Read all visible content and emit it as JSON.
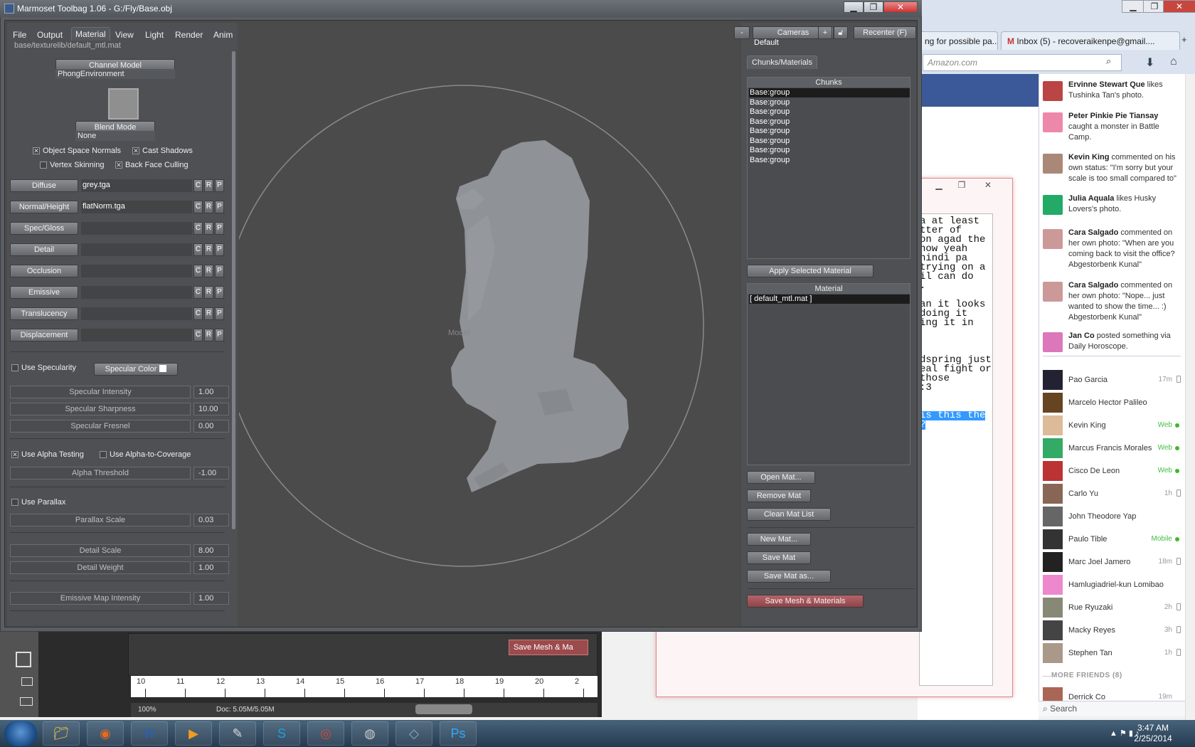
{
  "marmoset": {
    "title": "Marmoset Toolbag 1.06 - G:/Fly/Base.obj",
    "menu": [
      "File",
      "Output",
      "Material",
      "View",
      "Light",
      "Render",
      "Anim"
    ],
    "active_menu": "Material",
    "mat_path": "base/texturelib/default_mtl.mat",
    "channel_model": {
      "label": "Channel Model",
      "value": "PhongEnvironment"
    },
    "blend_mode": {
      "label": "Blend Mode",
      "value": "None"
    },
    "checks": [
      {
        "label": "Object Space Normals",
        "checked": true
      },
      {
        "label": "Cast Shadows",
        "checked": true
      },
      {
        "label": "Vertex Skinning",
        "checked": false
      },
      {
        "label": "Back Face Culling",
        "checked": true
      }
    ],
    "channels": [
      {
        "label": "Diffuse",
        "texture": "grey.tga"
      },
      {
        "label": "Normal/Height",
        "texture": "flatNorm.tga"
      },
      {
        "label": "Spec/Gloss",
        "texture": ""
      },
      {
        "label": "Detail",
        "texture": ""
      },
      {
        "label": "Occlusion",
        "texture": ""
      },
      {
        "label": "Emissive",
        "texture": ""
      },
      {
        "label": "Translucency",
        "texture": ""
      },
      {
        "label": "Displacement",
        "texture": ""
      }
    ],
    "crp": [
      "C",
      "R",
      "P"
    ],
    "use_specularity": {
      "label": "Use Specularity",
      "checked": false
    },
    "specular_color": "Specular Color",
    "spec_sliders": [
      {
        "label": "Specular Intensity",
        "value": "1.00",
        "level": 0.47
      },
      {
        "label": "Specular Sharpness",
        "value": "10.00",
        "level": 0.17
      },
      {
        "label": "Specular Fresnel",
        "value": "0.00",
        "level": 0.0
      }
    ],
    "alpha_testing": {
      "label": "Use Alpha Testing",
      "checked": true
    },
    "alpha_coverage": {
      "label": "Use Alpha-to-Coverage",
      "checked": false
    },
    "alpha_slider": {
      "label": "Alpha Threshold",
      "value": "-1.00",
      "level": 0.0
    },
    "use_parallax": {
      "label": "Use Parallax",
      "checked": false
    },
    "parallax_slider": {
      "label": "Parallax Scale",
      "value": "0.03",
      "level": 0.32
    },
    "detail_sliders": [
      {
        "label": "Detail Scale",
        "value": "8.00",
        "level": 0.43
      },
      {
        "label": "Detail Weight",
        "value": "1.00",
        "level": 0.31
      }
    ],
    "emissive_slider": {
      "label": "Emissive Map Intensity",
      "value": "1.00",
      "level": 0.31
    },
    "viewport_label": "Model",
    "cameras": {
      "minus": "-",
      "label": "Cameras",
      "plus": "+",
      "default": "Default"
    },
    "recenter": "Recenter (F)",
    "tab": "Chunks/Materials",
    "chunks_head": "Chunks",
    "chunks": [
      "Base:group",
      "Base:group",
      "Base:group",
      "Base:group",
      "Base:group",
      "Base:group",
      "Base:group",
      "Base:group"
    ],
    "apply_btn": "Apply Selected Material",
    "material_head": "Material",
    "materials": [
      "[ default_mtl.mat ]"
    ],
    "buttons": {
      "open": "Open Mat...",
      "remove": "Remove Mat",
      "clean": "Clean Mat List",
      "new": "New Mat...",
      "save": "Save Mat",
      "save_as": "Save Mat as...",
      "save_mesh": "Save Mesh & Materials"
    }
  },
  "browser": {
    "tabs": [
      "ng for possible pa...",
      "Inbox (5) - recoveraikenpe@gmail...."
    ],
    "url_placeholder": "Amazon.com"
  },
  "ticker": [
    {
      "name": "Ervinne Stewart Que",
      "text": " likes Tushinka Tan's photo."
    },
    {
      "name": "Peter Pinkie Pie Tiansay",
      "text": " caught a monster in Battle Camp."
    },
    {
      "name": "Kevin King",
      "text": " commented on his own status: \"I'm sorry but your scale is too small compared to\""
    },
    {
      "name": "Julia Aquala",
      "text": " likes Husky Lovers's photo."
    },
    {
      "name": "Cara Salgado",
      "text": " commented on her own photo: \"When are you coming back to visit the office? Abgestorbenk Kunal\""
    },
    {
      "name": "Cara Salgado",
      "text": " commented on her own photo: \"Nope... just wanted to show the time... :) Abgestorbenk Kunal\""
    },
    {
      "name": "Jan Co",
      "text": " posted something via Daily Horoscope."
    }
  ],
  "friends": [
    {
      "name": "Pao Garcia",
      "status": "17m",
      "kind": "phone"
    },
    {
      "name": "Marcelo Hector Palileo",
      "status": "",
      "kind": ""
    },
    {
      "name": "Kevin King",
      "status": "Web",
      "kind": "dot"
    },
    {
      "name": "Marcus Francis Morales",
      "status": "Web",
      "kind": "dot"
    },
    {
      "name": "Cisco De Leon",
      "status": "Web",
      "kind": "dot"
    },
    {
      "name": "Carlo Yu",
      "status": "1h",
      "kind": "phone"
    },
    {
      "name": "John Theodore Yap",
      "status": "",
      "kind": ""
    },
    {
      "name": "Paulo Tible",
      "status": "Mobile",
      "kind": "dot"
    },
    {
      "name": "Marc Joel Jamero",
      "status": "18m",
      "kind": "phone"
    },
    {
      "name": "Hamlugiadriel-kun Lomibao",
      "status": "",
      "kind": ""
    },
    {
      "name": "Rue Ryuzaki",
      "status": "2h",
      "kind": "phone"
    },
    {
      "name": "Macky Reyes",
      "status": "3h",
      "kind": "phone"
    },
    {
      "name": "Stephen Tan",
      "status": "1h",
      "kind": "phone"
    }
  ],
  "more_friends": "MORE FRIENDS (8)",
  "extra_friend": {
    "name": "Derrick Co",
    "status": "19m"
  },
  "chat_search": "Search",
  "notepad_lines": [
    "a at least",
    "tter of",
    "on agad the",
    " now yeah",
    "hindi pa",
    " trying on a",
    "il can do",
    ".",
    "",
    "an it looks",
    "doing it",
    "ing it in",
    "",
    "",
    "",
    "dspring just",
    "eal fight or",
    " those",
    ":3",
    "",
    "",
    " is this the",
    "?"
  ],
  "photoshop": {
    "save_btn": "Save Mesh & Ma",
    "ruler": [
      "10",
      "11",
      "12",
      "13",
      "14",
      "15",
      "16",
      "17",
      "18",
      "19",
      "20",
      "2"
    ],
    "zoom": "100%",
    "doc": "Doc: 5.05M/5.05M"
  },
  "taskbar": {
    "apps": [
      "Windows Explorer",
      "Firefox",
      "Word",
      "Media Player",
      "Inkscape",
      "Skype",
      "Chrome",
      "Marmoset",
      "Paint",
      "Photoshop"
    ],
    "time": "3:47 AM",
    "date": "2/25/2014"
  }
}
